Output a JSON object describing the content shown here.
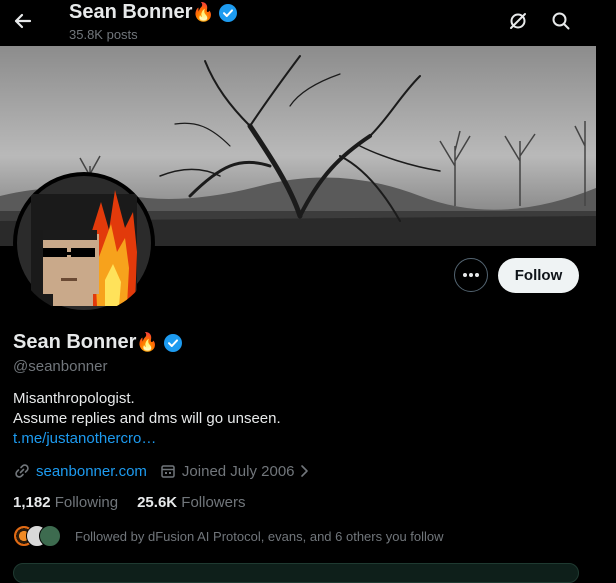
{
  "header": {
    "name": "Sean Bonner",
    "name_emoji": "🔥",
    "posts_count": "35.8K posts"
  },
  "profile": {
    "display_name": "Sean Bonner",
    "name_emoji": "🔥",
    "verified": true,
    "handle": "@seanbonner",
    "follow_label": "Follow",
    "bio_lines": [
      "Misanthropologist.",
      "Assume replies and dms will go unseen."
    ],
    "bio_link": "t.me/justanothercro…",
    "website": "seanbonner.com",
    "joined": "Joined July 2006",
    "following_count": "1,182",
    "following_label": "Following",
    "followers_count": "25.6K",
    "followers_label": "Followers",
    "followed_by": "Followed by dFusion AI Protocol, evans, and 6 others you follow"
  },
  "icons": {
    "back": "back-arrow-icon",
    "grok": "grok-icon",
    "search": "search-icon",
    "more": "more-icon",
    "verified": "verified-badge-icon",
    "link": "link-icon",
    "calendar": "calendar-icon",
    "chevron": "chevron-right-icon"
  },
  "colors": {
    "background": "#000000",
    "text": "#e7e9ea",
    "muted": "#71767b",
    "link": "#1d9bf0",
    "verified": "#1d9bf0",
    "follow_button_bg": "#eff3f4"
  }
}
